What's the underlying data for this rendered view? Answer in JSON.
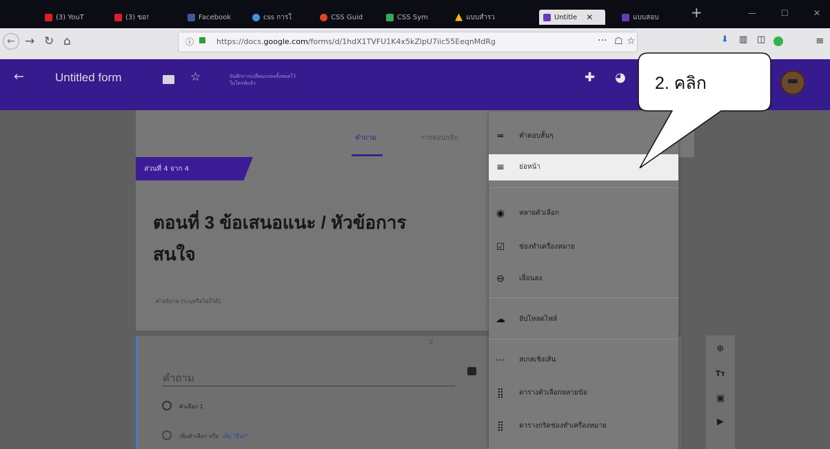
{
  "browser": {
    "tabs": [
      {
        "label": "(3) YouT",
        "color": "#e01e2a"
      },
      {
        "label": "(3) ขอ!",
        "color": "#e01e2a"
      },
      {
        "label": "Facebook",
        "color": "#3b5998"
      },
      {
        "label": "css การใ",
        "color": "#4a90d9"
      },
      {
        "label": "CSS Guid",
        "color": "#d9481f"
      },
      {
        "label": "CSS Sym",
        "color": "#34a853"
      },
      {
        "label": "แบบสำรว",
        "color": "#fbbc05"
      },
      {
        "label": "Untitle",
        "color": "#673ab7",
        "active": true
      },
      {
        "label": "แบบสอบ",
        "color": "#673ab7"
      }
    ],
    "new_tab": "+",
    "window_controls": {
      "minimize": "—",
      "maximize": "☐",
      "close": "✕"
    },
    "url_prefix": "https://docs.",
    "url_domain": "google.com",
    "url_rest": "/forms/d/1hdX1TVFU1K4x5kZlpU7iic55EeqnMdRg",
    "url_more": "···"
  },
  "forms_header": {
    "title": "Untitled form",
    "saved_note_line1": "บันทึกการเปลี่ยนแปลงทั้งหมดไว้",
    "saved_note_line2": "ในไดรฟ์แล้ว"
  },
  "form_tabs": {
    "questions": "คำถาม",
    "responses": "การตอบกลับ"
  },
  "section": {
    "label": "ส่วนที่ 4 จาก 4",
    "title_line1": "ตอนที่ 3 ข้อเสนอแนะ / หัวข้อการ",
    "title_line2": "สนใจ",
    "description": "คำอธิบาย (ระบุหรือไม่ก็ได้)"
  },
  "question": {
    "placeholder": "คำถาม",
    "option1": "ตัวเลือก 1",
    "add_option": "เพิ่มตัวเลือก หรือ",
    "add_other": "เพิ่ม \"อื่นๆ\""
  },
  "menu": {
    "items": [
      {
        "label": "คำตอบสั้นๆ",
        "icon": "short-answer-icon"
      },
      {
        "label": "ย่อหน้า",
        "icon": "paragraph-icon"
      },
      {
        "label": "หลายตัวเลือก",
        "icon": "radio-icon"
      },
      {
        "label": "ช่องทำเครื่องหมาย",
        "icon": "checkbox-icon"
      },
      {
        "label": "เลื่อนลง",
        "icon": "dropdown-icon"
      },
      {
        "label": "อัปโหลดไฟล์",
        "icon": "upload-icon"
      },
      {
        "label": "สเกลเชิงเส้น",
        "icon": "linear-scale-icon"
      },
      {
        "label": "ตารางตัวเลือกหลายข้อ",
        "icon": "grid-icon"
      },
      {
        "label": "ตารางกริดช่องทำเครื่องหมาย",
        "icon": "grid-icon"
      }
    ]
  },
  "callout": {
    "text": "2. คลิก"
  },
  "colors": {
    "purple": "#361b8f",
    "accent": "#673ab7",
    "highlight": "#eeeeee"
  }
}
